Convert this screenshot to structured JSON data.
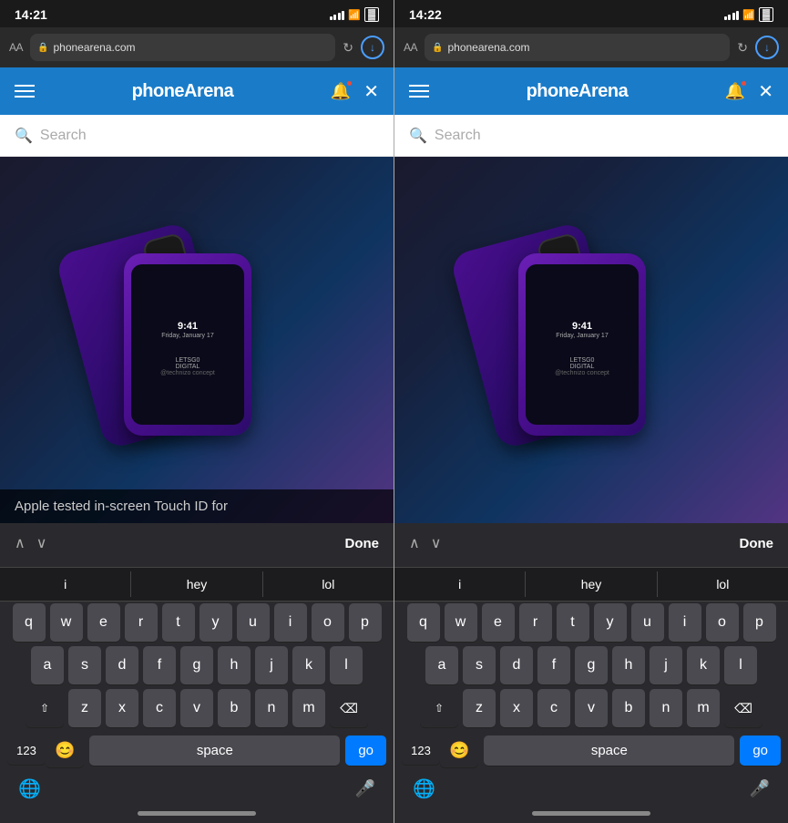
{
  "left": {
    "statusBar": {
      "time": "14:21",
      "icons": "signal wifi battery"
    },
    "browserBar": {
      "aa": "AA",
      "url": "phonearena.com",
      "refresh": "↻",
      "download": "↓"
    },
    "siteHeader": {
      "title": "phoneArena",
      "bell": "🔔",
      "close": "✕"
    },
    "search": {
      "placeholder": "Search"
    },
    "articleOverlay": "Apple tested in-screen Touch ID for",
    "findToolbar": {
      "up": "∧",
      "down": "∨",
      "done": "Done"
    },
    "keyboard": {
      "suggestions": [
        "i",
        "hey",
        "lol"
      ],
      "row1": [
        "q",
        "w",
        "e",
        "r",
        "t",
        "y",
        "u",
        "i",
        "o",
        "p"
      ],
      "row2": [
        "a",
        "s",
        "d",
        "f",
        "g",
        "h",
        "j",
        "k",
        "l"
      ],
      "row3": [
        "z",
        "x",
        "c",
        "v",
        "b",
        "n",
        "m"
      ],
      "num": "123",
      "emoji": "😊",
      "space": "space",
      "go": "go",
      "delete": "⌫",
      "shift": "⇧",
      "globe": "🌐",
      "mic": "🎤"
    }
  },
  "right": {
    "statusBar": {
      "time": "14:22",
      "icons": "signal wifi battery"
    },
    "browserBar": {
      "aa": "AA",
      "url": "phonearena.com",
      "refresh": "↻",
      "download": "↓"
    },
    "siteHeader": {
      "title": "phoneArena",
      "bell": "🔔",
      "close": "✕"
    },
    "search": {
      "placeholder": "Search"
    },
    "findToolbar": {
      "up": "∧",
      "down": "∨",
      "done": "Done"
    },
    "keyboard": {
      "suggestions": [
        "i",
        "hey",
        "lol"
      ],
      "row1": [
        "q",
        "w",
        "e",
        "r",
        "t",
        "y",
        "u",
        "i",
        "o",
        "p"
      ],
      "row2": [
        "a",
        "s",
        "d",
        "f",
        "g",
        "h",
        "j",
        "k",
        "l"
      ],
      "row3": [
        "z",
        "x",
        "c",
        "v",
        "b",
        "n",
        "m"
      ],
      "num": "123",
      "emoji": "😊",
      "space": "space",
      "go": "go",
      "delete": "⌫",
      "shift": "⇧",
      "globe": "🌐",
      "mic": "🎤"
    }
  }
}
